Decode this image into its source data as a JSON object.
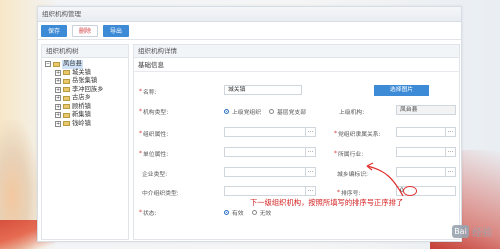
{
  "app": {
    "title": "组织机构管理"
  },
  "toolbar": {
    "save": "保存",
    "delete": "删除",
    "export": "导出"
  },
  "left_pane": {
    "header": "组织机构树",
    "root": {
      "toggle": "−",
      "label": "凤台县"
    },
    "children": [
      {
        "toggle": "+",
        "label": "城关镇"
      },
      {
        "toggle": "+",
        "label": "岳张集镇"
      },
      {
        "toggle": "+",
        "label": "李冲回族乡"
      },
      {
        "toggle": "+",
        "label": "古店乡"
      },
      {
        "toggle": "+",
        "label": "顾桥镇"
      },
      {
        "toggle": "+",
        "label": "新集镇"
      },
      {
        "toggle": "+",
        "label": "钱岭镇"
      }
    ]
  },
  "right_pane": {
    "header": "组织机构详情",
    "section": "基础信息",
    "fields": {
      "name_label": "名称:",
      "name_value": "城关镇",
      "select_button": "选择图片",
      "org_type_label": "机构类型:",
      "org_type_options": [
        "上级党组织",
        "基层党支部"
      ],
      "parent_label": "上级机构:",
      "parent_value": "凤台县",
      "org_attr_label": "组织属性:",
      "affiliation_label": "党组织隶属关系:",
      "unit_attr_label": "单位属性:",
      "industry_label": "所属行业:",
      "enterprise_type_label": "企业类型:",
      "city_id_label": "城乡编标识:",
      "intermediary_label": "中介组织类型:",
      "sort_label": "排序号:",
      "sort_value": "0",
      "status_label": "状态:",
      "status_options": [
        "有效",
        "无效"
      ],
      "dots": "..."
    }
  },
  "annotation": {
    "text": "下一级组织机构，按照所填写的排序号正序排了"
  },
  "watermark": {
    "badge": "Bai",
    "text": "经验"
  }
}
